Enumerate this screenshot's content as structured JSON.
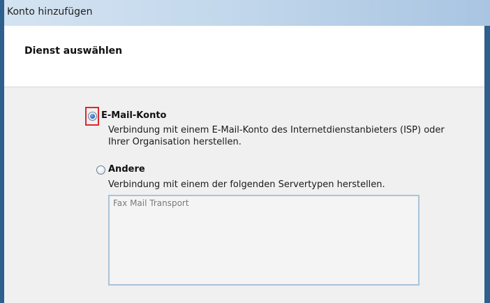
{
  "window": {
    "title": "Konto hinzufügen"
  },
  "header": {
    "heading": "Dienst auswählen"
  },
  "options": {
    "email": {
      "label": "E-Mail-Konto",
      "description_line1": "Verbindung mit einem E-Mail-Konto des Internetdienstanbieters (ISP) oder",
      "description_line2": "Ihrer Organisation herstellen.",
      "selected": true
    },
    "other": {
      "label": "Andere",
      "description": "Verbindung mit einem der folgenden Servertypen herstellen.",
      "selected": false,
      "server_types": [
        "Fax Mail Transport"
      ]
    }
  },
  "colors": {
    "highlight": "#e0272a",
    "window_border": "#2e5f8d",
    "listbox_border": "#a9c3d9"
  }
}
